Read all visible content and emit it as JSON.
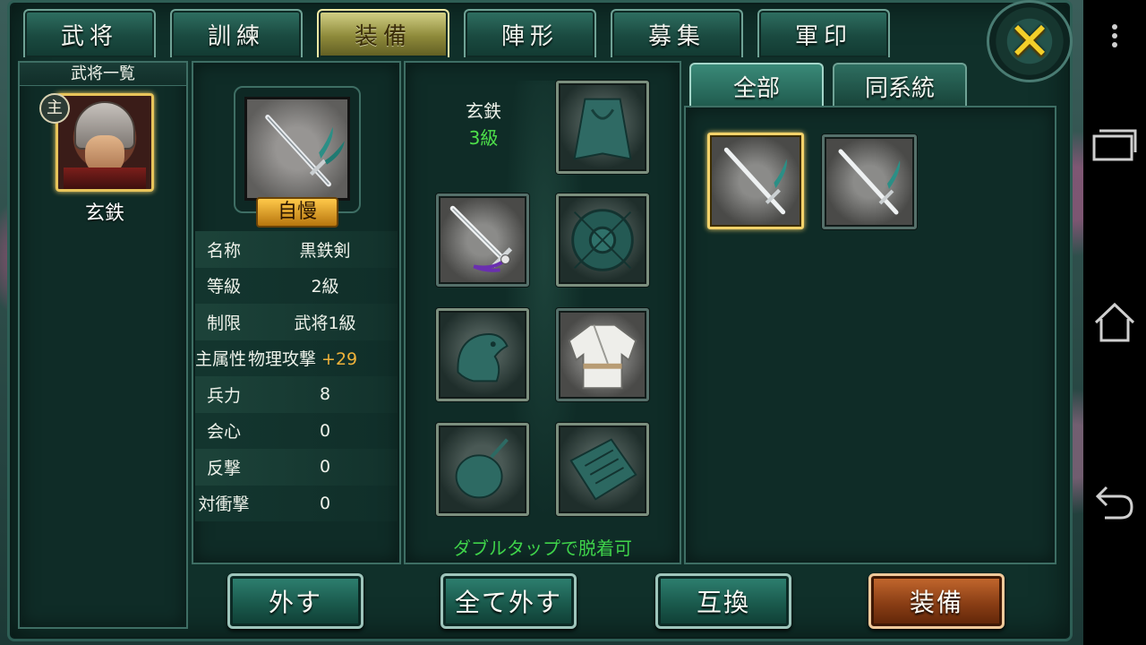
{
  "tabs": [
    {
      "label": "武将",
      "active": false
    },
    {
      "label": "訓練",
      "active": false
    },
    {
      "label": "装備",
      "active": true
    },
    {
      "label": "陣形",
      "active": false
    },
    {
      "label": "募集",
      "active": false
    },
    {
      "label": "軍印",
      "active": false
    }
  ],
  "close_icon": "close-x-icon",
  "hero_list": {
    "title": "武将一覧",
    "heroes": [
      {
        "name": "玄鉄",
        "badge": "主",
        "selected": true
      }
    ]
  },
  "item_info": {
    "rarity": "自慢",
    "stats": [
      {
        "key": "名称",
        "value": "黒鉄剣"
      },
      {
        "key": "等級",
        "value": "2級"
      },
      {
        "key": "制限",
        "value": "武将1級"
      },
      {
        "key": "主属性",
        "value": "物理攻撃",
        "bonus": "+29"
      },
      {
        "key": "兵力",
        "value": "8"
      },
      {
        "key": "会心",
        "value": "0"
      },
      {
        "key": "反撃",
        "value": "0"
      },
      {
        "key": "対衝撃",
        "value": "0"
      }
    ]
  },
  "equipment": {
    "hero_name": "玄鉄",
    "hero_level": "3級",
    "slots": [
      {
        "name": "armor-slot",
        "icon": "cape-icon",
        "filled": false
      },
      {
        "name": "weapon-slot",
        "icon": "sword-icon",
        "filled": true
      },
      {
        "name": "shield-slot",
        "icon": "shield-icon",
        "filled": false
      },
      {
        "name": "mount-slot",
        "icon": "horse-icon",
        "filled": false
      },
      {
        "name": "robe-slot",
        "icon": "robe-icon",
        "filled": true
      },
      {
        "name": "accessory-slot",
        "icon": "amulet-icon",
        "filled": false
      },
      {
        "name": "book-slot",
        "icon": "scroll-icon",
        "filled": false
      }
    ],
    "hint": "ダブルタップで脱着可"
  },
  "inventory": {
    "tabs": [
      {
        "label": "全部",
        "active": true
      },
      {
        "label": "同系統",
        "active": false
      }
    ],
    "items": [
      {
        "icon": "sword-icon",
        "selected": true
      },
      {
        "icon": "sword-icon",
        "selected": false
      }
    ]
  },
  "buttons": {
    "unequip": "外す",
    "unequip_all": "全て外す",
    "swap": "互換",
    "equip": "装備"
  },
  "android_nav": [
    "menu-dots-icon",
    "recent-apps-icon",
    "home-icon",
    "back-icon"
  ]
}
